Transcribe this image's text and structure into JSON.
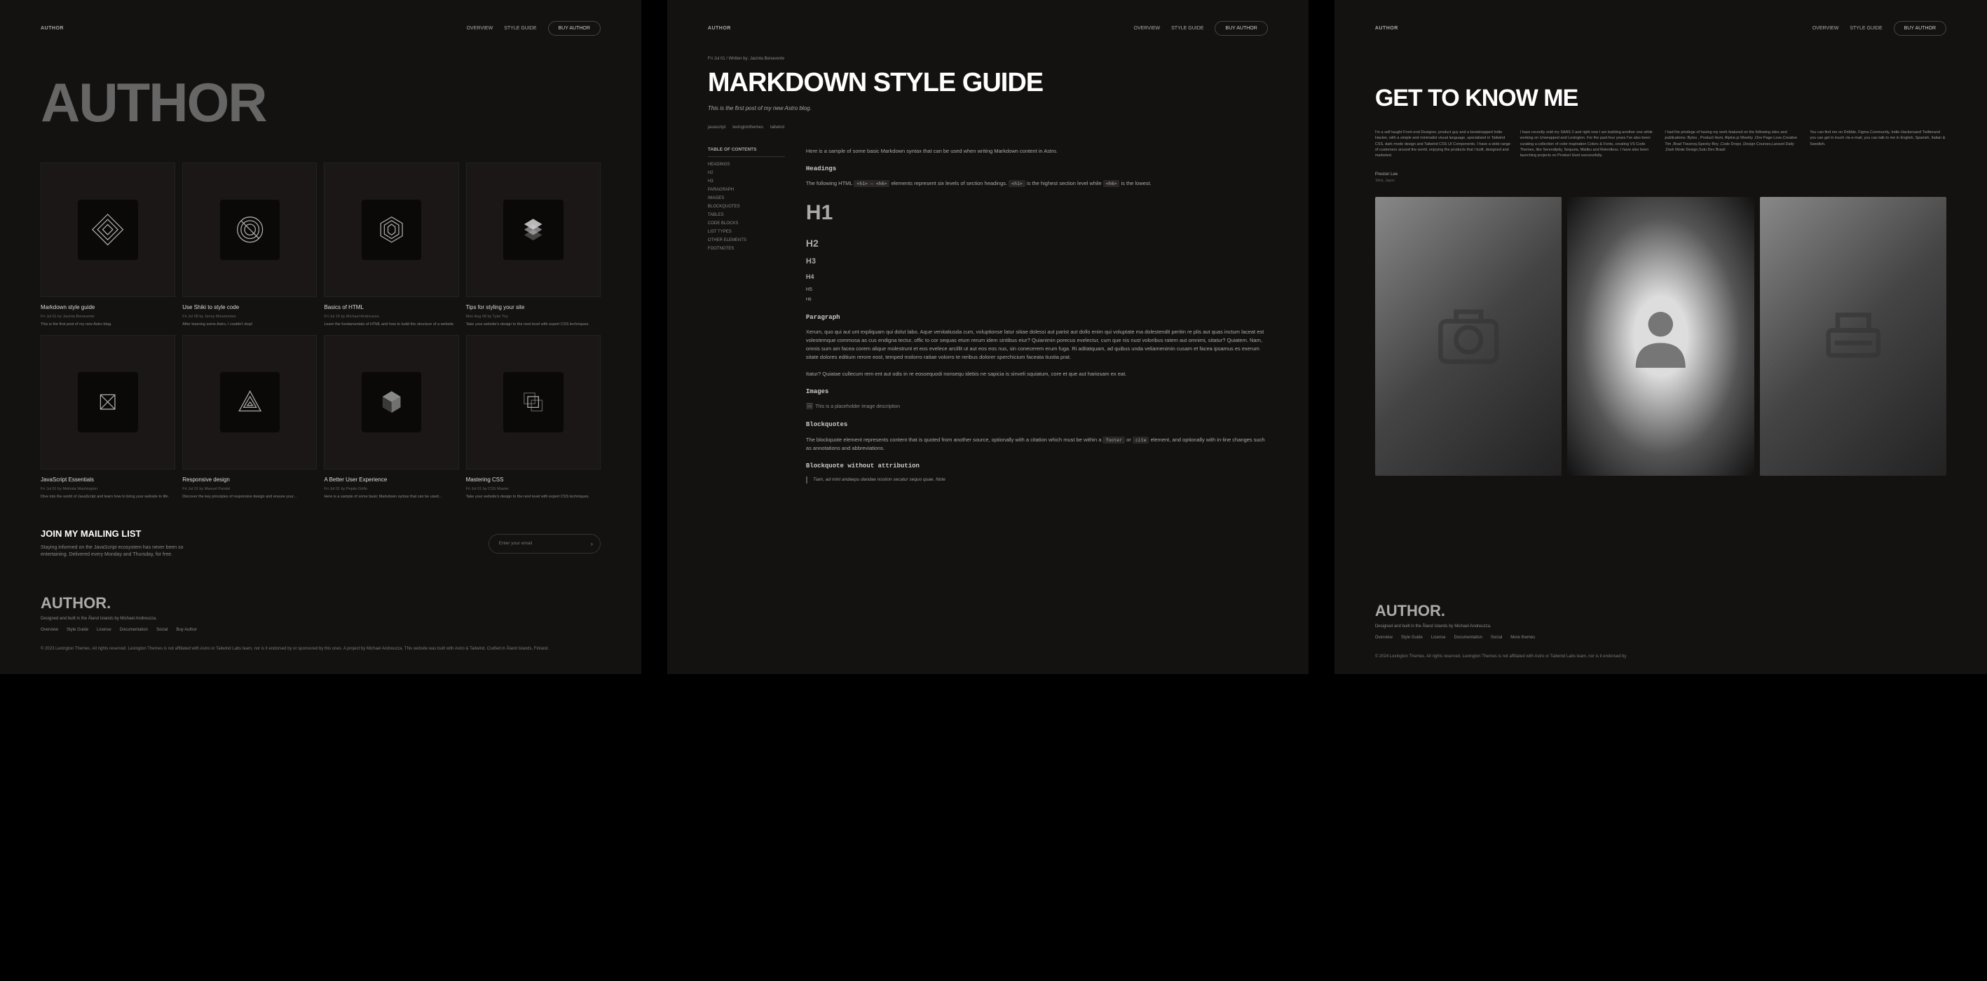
{
  "header": {
    "logo": "AUTHOR",
    "nav": {
      "overview": "OVERVIEW",
      "style": "STYLE GUIDE",
      "buy": "BUY AUTHOR"
    }
  },
  "panel1": {
    "hero": "AUTHOR",
    "posts": [
      {
        "title": "Markdown style guide",
        "meta": "Fri Jul 01 by Jacinta Benavente",
        "desc": "This is the first post of my new Astro blog."
      },
      {
        "title": "Use Shiki to style code",
        "meta": "Fri Jul 08 by Jenny Miramontes",
        "desc": "After learning some Astro, I couldn't stop!"
      },
      {
        "title": "Basics of HTML",
        "meta": "Fri Jul 15 by Michael Andreuzza",
        "desc": "Learn the fundamentals of HTML and how to build the structure of a website"
      },
      {
        "title": "Tips for styling your site",
        "meta": "Mon Aug 08 by Tyler Toy",
        "desc": "Take your website's design to the next level with expert CSS techniques."
      },
      {
        "title": "JavaScript Essentials",
        "meta": "Fri Jul 01 by Melinda Washington",
        "desc": "Dive into the world of JavaScript and learn how to bring your website to life."
      },
      {
        "title": "Responsive design",
        "meta": "Fri Jul 01 by Manuel Pandel",
        "desc": "Discover the key principles of responsive design and ensure your..."
      },
      {
        "title": "A Better User Experience",
        "meta": "Fri Jul 01 by Pepito Grillo",
        "desc": "Here is a sample of some basic Markdown syntax that can be used..."
      },
      {
        "title": "Mastering CSS",
        "meta": "Fri Jul 01 by CSS Master",
        "desc": "Take your website's design to the next level with expert CSS techniques."
      }
    ],
    "mailing": {
      "title": "JOIN MY MAILING LIST",
      "desc": "Staying informed on the JavaScript ecosystem has never been so entertaining. Delivered every Monday and Thursday, for free.",
      "placeholder": "Enter your email"
    }
  },
  "footer": {
    "logo": "AUTHOR.",
    "sub": "Designed and built in the Åland Islands by Michael Andreuzza.",
    "links": [
      "Overview",
      "Style Guide",
      "License",
      "Documentation",
      "Social",
      "Buy Author"
    ],
    "links3": [
      "Overview",
      "Style Guide",
      "License",
      "Documentation",
      "Social",
      "More themes"
    ],
    "copy1": "© 2023 Lexington Themes. All rights reserved. Lexington Themes is not affiliated with Astro or Tailwind Labs team, nor is it endorsed by or sponsored by this ones. A project by Michael Andreuzza. This website was built with Astro & Tailwind. Crafted in Åland Islands, Finland.",
    "copy3": "© 2024 Lexington Themes. All rights reserved. Lexington Themes is not affiliated with Astro or Tailwind Labs team, nor is it endorsed by"
  },
  "panel2": {
    "meta": "Fri Jul 01 / Written by: Jacinta Benavente",
    "title": "MARKDOWN STYLE GUIDE",
    "subtitle": "This is the first post of my new Astro blog.",
    "tags": [
      "javascript",
      "lexingtonthemes",
      "tailwind"
    ],
    "toc_title": "TABLE OF CONTENTS",
    "toc": [
      "HEADINGS",
      "H2",
      "H3",
      "PARAGRAPH",
      "IMAGES",
      "BLOCKQUOTES",
      "TABLES",
      "CODE BLOCKS",
      "LIST TYPES",
      "OTHER ELEMENTS",
      "FOOTNOTES"
    ],
    "intro": "Here is a sample of some basic Markdown syntax that can be used when writing Markdown content in Astro.",
    "headings_title": "Headings",
    "headings_p1": "The following HTML",
    "headings_p2": "elements represent six levels of section headings.",
    "headings_p3": "is the highest section level while",
    "headings_p4": "is the lowest.",
    "h1_h6": "<h1> — <h6>",
    "h1_code": "<h1>",
    "h6_code": "<h6>",
    "h1": "H1",
    "h2": "H2",
    "h3": "H3",
    "h4": "H4",
    "h5": "H5",
    "h6": "H6",
    "para_title": "Paragraph",
    "para1": "Xerum, quo qui aut unt expliquam qui dolut labo. Aque venitatiusda cum, voluptionse latur sitiae dolessi aut parist aut dollo enim qui voluptate ma dolestendit peritin re plis aut quas inctum laceat est volestemque commosa as cus endigna tectur, offic to cor sequas etum rerum idem sintibus eiur? Quianimin porecus evelectur, cum que nis nust voloribus ratem aut omnimi, sitatur? Quiatem. Nam, omnis sum am facea corem alique molestrunt et eos evelece arcillit ut aut eos eos nus, sin conecerem erum fuga. Ri aditatquam, ad quibus unda veliamenimin cusam et facea ipsamus es exerum sitate dolores editium rerore eost, temped molorro ratiae volorro te reribus dolorer sperchicium faceata tiustia prat.",
    "para2": "Itatur? Quiatae cullecum rem ent aut odis in re eossequodi nonsequ idebis ne sapicia is sinveli squiatum, core et que aut hariosam ex eat.",
    "images_title": "Images",
    "img_alt": "This is a placeholder image description",
    "bq_title": "Blockquotes",
    "bq_p1": "The blockquote element represents content that is quoted from another source, optionally with a citation which must be within a",
    "bq_footer": "footer",
    "bq_or": "or",
    "bq_cite": "cite",
    "bq_p2": "element, and optionally with in-line changes such as annotations and abbreviations.",
    "bq_no_attr": "Blockquote without attribution",
    "bq_quote": "Tiam, ad mint andaepu dandae nostion secatur sequo quae. Note"
  },
  "panel3": {
    "title": "GET TO KNOW ME",
    "cols": [
      "I'm a self taught Front-end Designer, product guy and a bootstrapped Indie Hacker, with a simple and minimalist visual language, specialised in Tailwind CSS, dark mode design and Tailwind CSS UI Components. I have a wide range of customers around the world, enjoying the products that I built, designed and marketed.",
      "I have recently sold my SAAS 2 and right now I am building another one while working on Unwrapped and Lexington. For the past four years I've also been curating a collection of color inspiration Colors & Fonts, creating VS Code Themes, like Serendipity, Sequoia, Malibu and Relentless. I have also been launching projects on Product Hunt successfully.",
      "I had the privilege of having my work featured on the following sites and publications: Bytes , Product Hunt, Alpine.js Weekly ,One Page Love,Creative Tim ,Brad Traversy,Specky Boy ,Code Drops ,Design Courses,Laravel Daily ,Dark Mode Design,Sulu Dev Brasil",
      "You can find me on Dribble, Figma Community, Indie Hackersand Twitterand you can get in touch via e-mail, you can talk to me in English, Spanish, Italian & Swedish."
    ],
    "name": "Preston Lee",
    "loc": "Tokio, Japon"
  }
}
